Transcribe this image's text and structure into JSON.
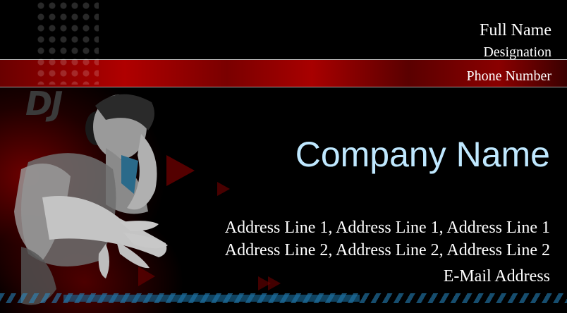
{
  "card": {
    "full_name": "Full Name",
    "designation": "Designation",
    "phone": "Phone Number",
    "company": "Company Name",
    "address_line_1": "Address Line 1, Address Line 1, Address Line 1",
    "address_line_2": "Address Line 2, Address Line 2, Address Line 2",
    "email": "E-Mail Address"
  },
  "logo_text": "DJ",
  "colors": {
    "background": "#000000",
    "band_red": "#b00000",
    "company_text": "#bfe8ff",
    "text": "#ffffff",
    "accent_blue": "#1a6fa0"
  }
}
